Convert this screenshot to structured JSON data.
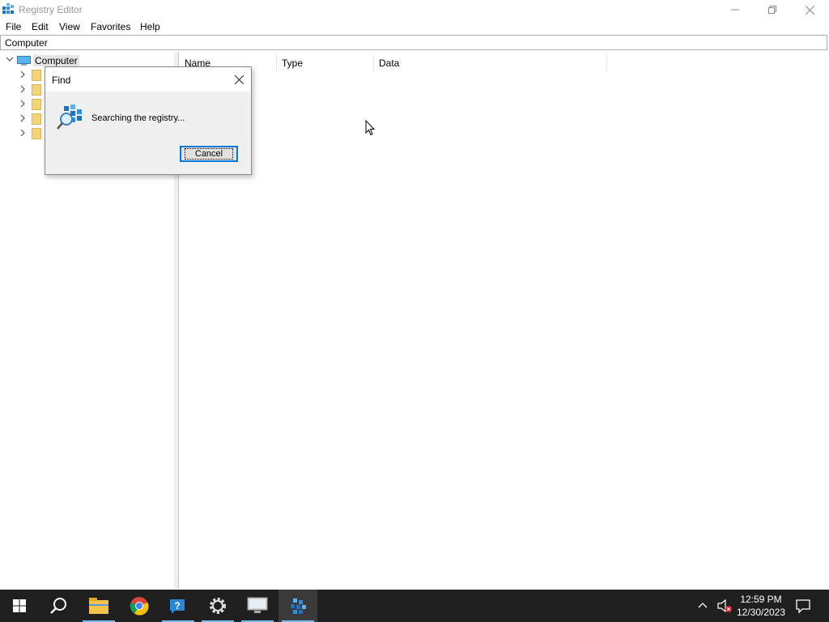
{
  "window": {
    "title": "Registry Editor"
  },
  "menu": [
    "File",
    "Edit",
    "View",
    "Favorites",
    "Help"
  ],
  "address": "Computer",
  "tree": {
    "root_label": "Computer",
    "child_count": 5
  },
  "columns": [
    "Name",
    "Type",
    "Data"
  ],
  "find_dialog": {
    "title": "Find",
    "message": "Searching the registry...",
    "cancel_label": "Cancel"
  },
  "taskbar": {
    "apps": [
      "start",
      "search",
      "file-explorer",
      "chrome",
      "help",
      "settings",
      "remote-desktop",
      "registry-editor"
    ],
    "time": "12:59 PM",
    "date": "12/30/2023"
  }
}
